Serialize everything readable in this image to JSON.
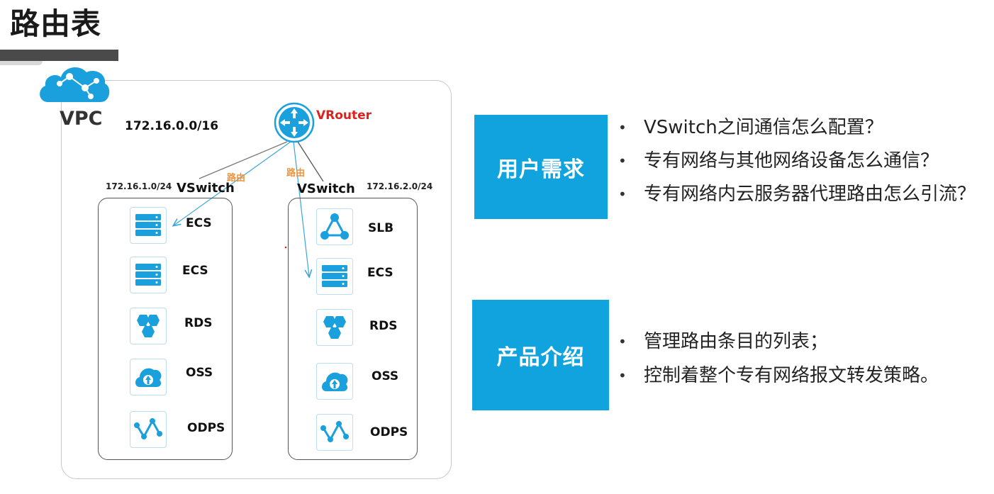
{
  "page": {
    "title": "路由表"
  },
  "diagram": {
    "vpc_label": "VPC",
    "vpc_cidr": "172.16.0.0/16",
    "router_label": "VRouter",
    "route_labels": [
      "路由",
      "路由"
    ],
    "vswitches": [
      {
        "label": "VSwitch",
        "cidr": "172.16.1.0/24",
        "services": [
          {
            "icon": "ecs-server-icon",
            "label": "ECS"
          },
          {
            "icon": "ecs-server-icon",
            "label": "ECS"
          },
          {
            "icon": "rds-database-icon",
            "label": "RDS"
          },
          {
            "icon": "oss-storage-icon",
            "label": "OSS"
          },
          {
            "icon": "odps-compute-icon",
            "label": "ODPS"
          }
        ]
      },
      {
        "label": "VSwitch",
        "cidr": "172.16.2.0/24",
        "services": [
          {
            "icon": "slb-balancer-icon",
            "label": "SLB"
          },
          {
            "icon": "ecs-server-icon",
            "label": "ECS"
          },
          {
            "icon": "rds-database-icon",
            "label": "RDS"
          },
          {
            "icon": "oss-storage-icon",
            "label": "OSS"
          },
          {
            "icon": "odps-compute-icon",
            "label": "ODPS"
          }
        ]
      }
    ]
  },
  "user_needs": {
    "heading": "用户需求",
    "items": [
      "VSwitch之间通信怎么配置？",
      "专有网络与其他网络设备怎么通信？",
      "专有网络内云服务器代理路由怎么引流？"
    ]
  },
  "product_intro": {
    "heading": "产品介绍",
    "items": [
      "管理路由条目的列表；",
      "控制着整个专有网络报文转发策略。"
    ]
  },
  "colors": {
    "accent": "#11a3dd",
    "icon_blue": "#1aa0dc",
    "router_red": "#e0201a",
    "route_orange": "#f0933a"
  }
}
